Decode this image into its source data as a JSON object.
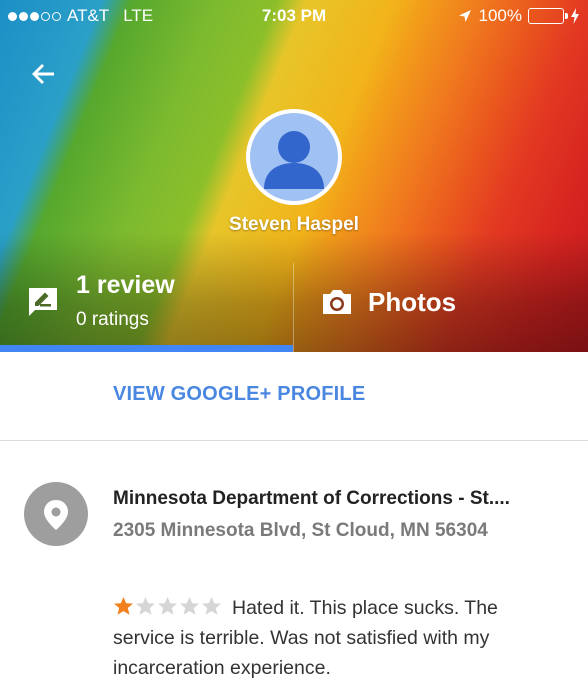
{
  "status_bar": {
    "carrier": "AT&T",
    "network": "LTE",
    "time": "7:03 PM",
    "battery": "100%",
    "signal_dots_filled": 3,
    "signal_dots_total": 5
  },
  "profile": {
    "name": "Steven Haspel"
  },
  "tabs": {
    "reviews_title": "1 review",
    "reviews_subtitle": "0 ratings",
    "photos_label": "Photos",
    "active": "reviews"
  },
  "links": {
    "google_plus": "VIEW GOOGLE+ PROFILE"
  },
  "review": {
    "place_name": "Minnesota Department of Corrections - St....",
    "place_address": "2305 Minnesota Blvd, St Cloud, MN 56304",
    "rating": 1,
    "rating_max": 5,
    "text": "Hated it. This place sucks. The service is terrible. Was not satisfied with my incarceration experience."
  },
  "colors": {
    "accent_blue": "#4285f4",
    "link_blue": "#4a87e0",
    "star_filled": "#f1811c",
    "star_empty": "#d6d6d6",
    "battery_green": "#4cd964"
  },
  "icons": {
    "back": "arrow-left-icon",
    "review_tab": "rate-review-icon",
    "photos_tab": "camera-icon",
    "place": "map-pin-icon",
    "avatar": "person-icon"
  }
}
